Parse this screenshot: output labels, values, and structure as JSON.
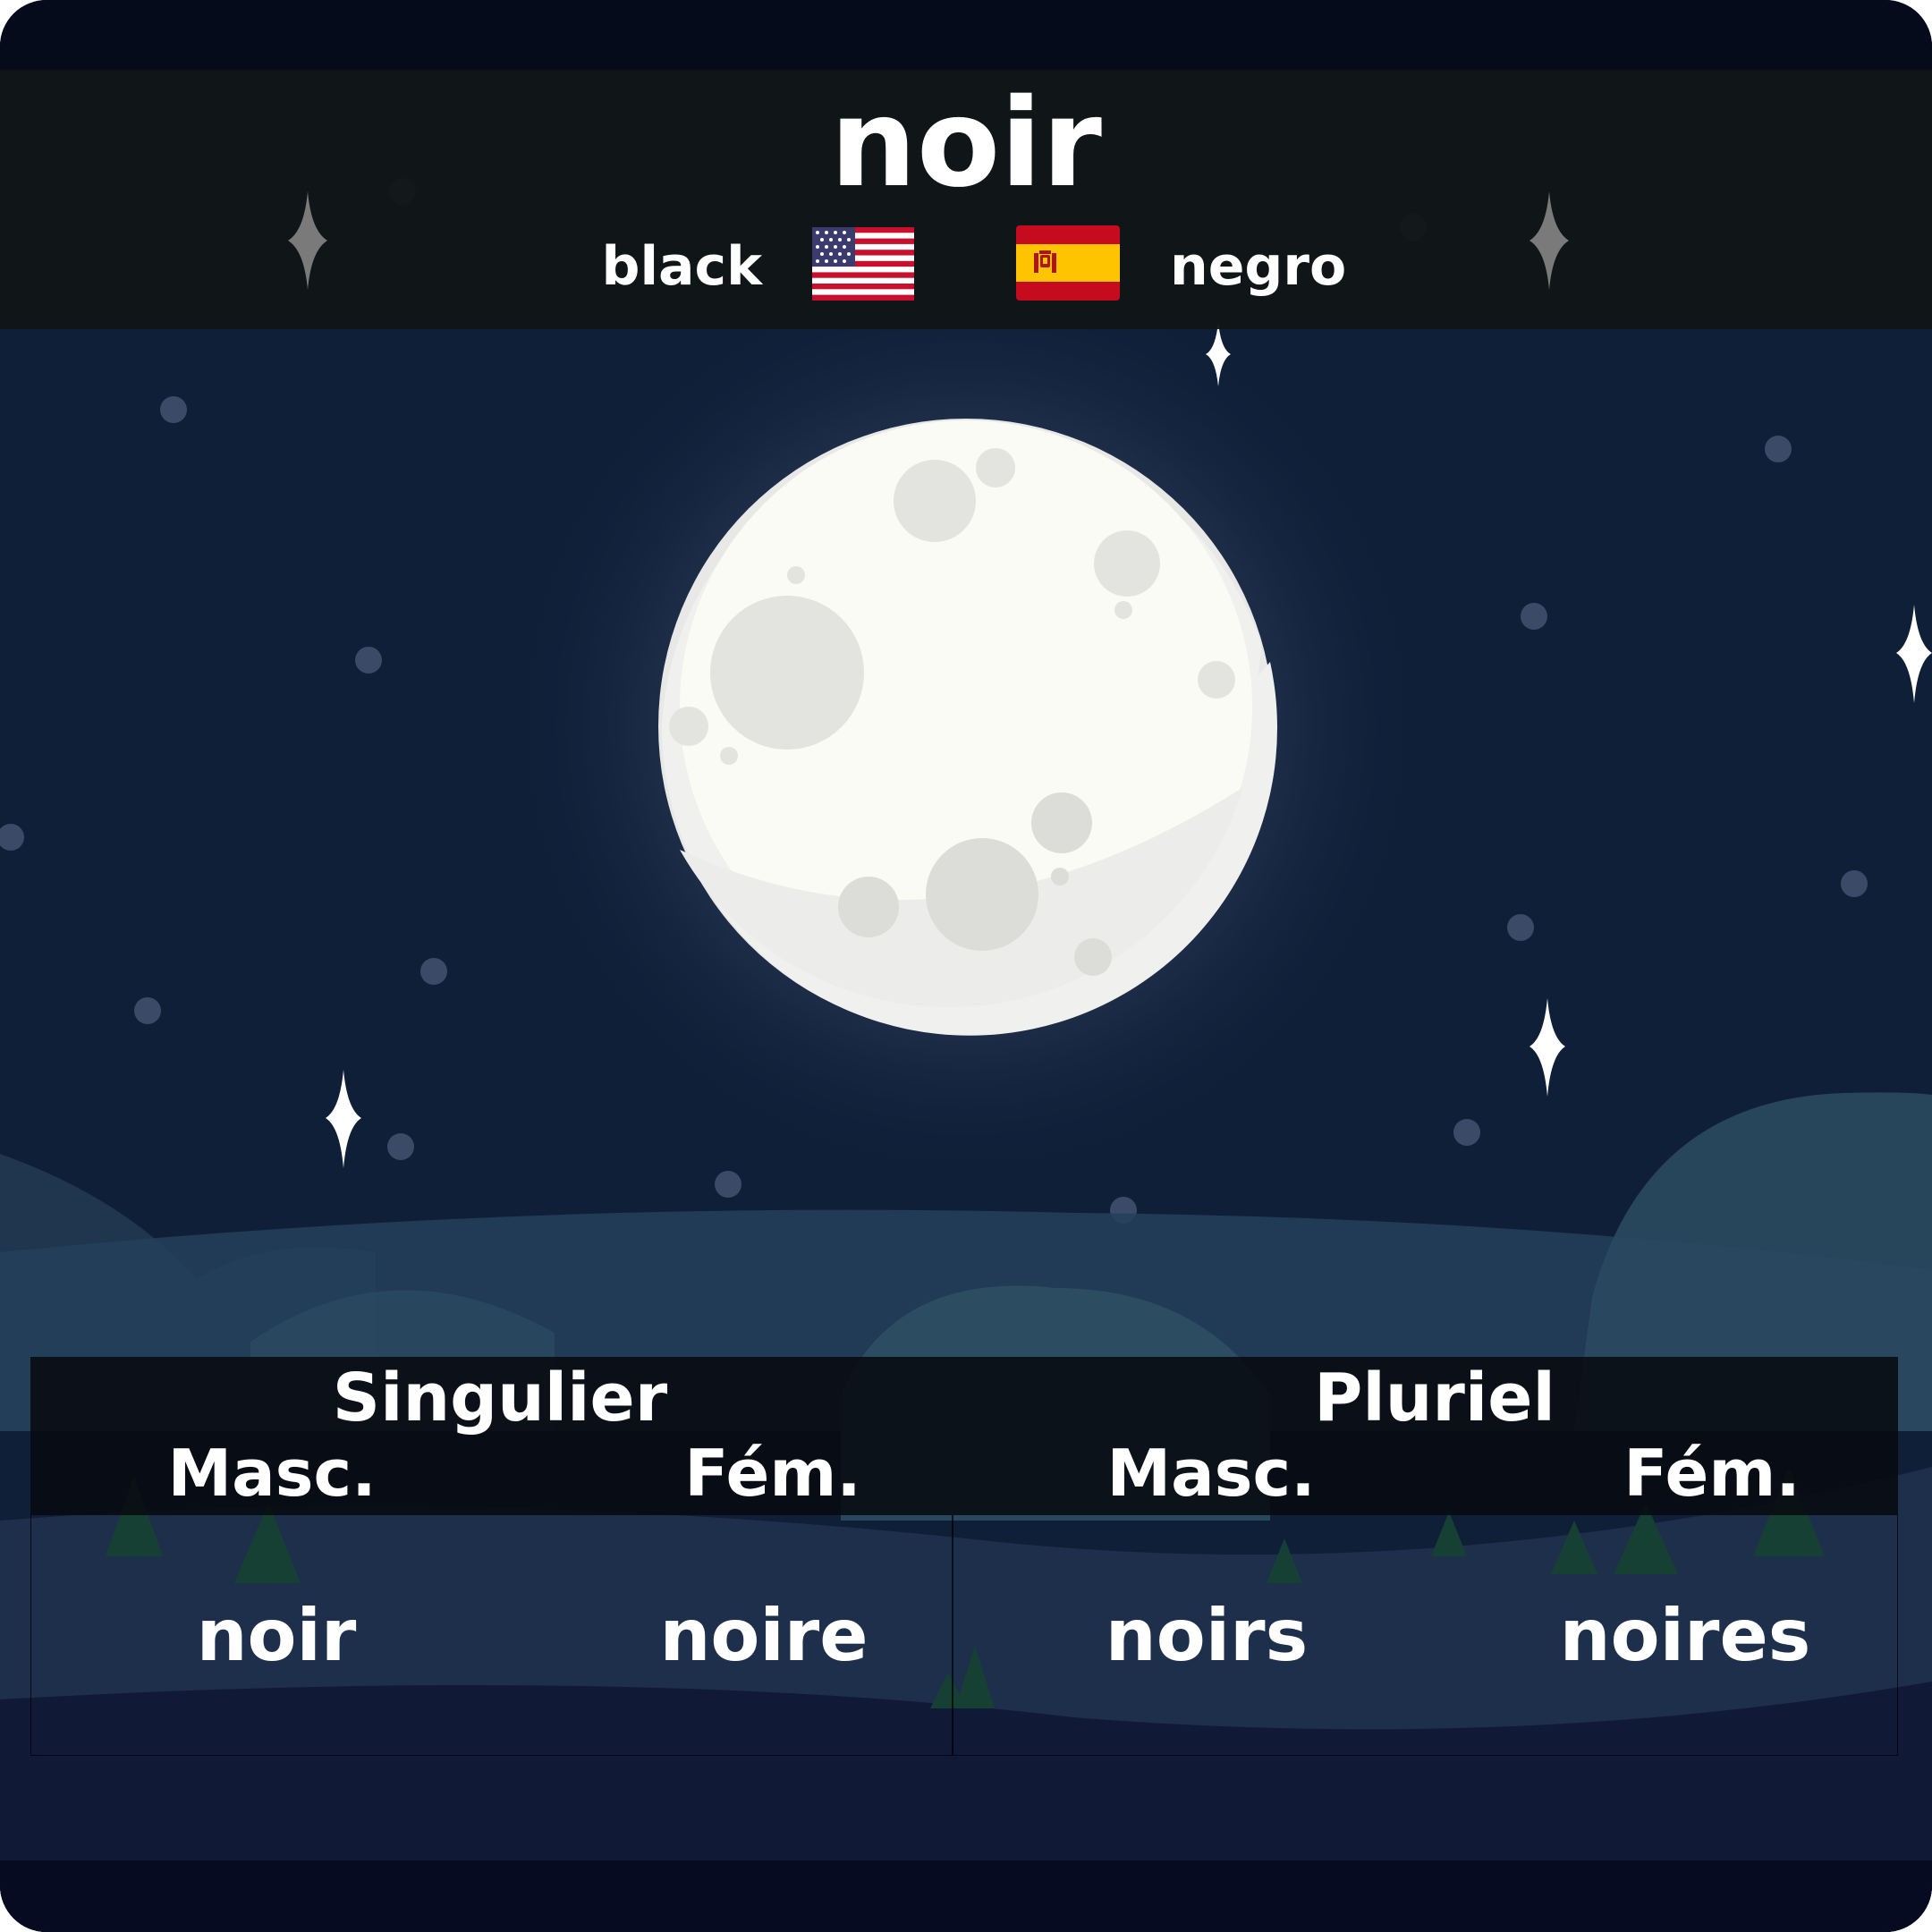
{
  "word": {
    "headword": "noir",
    "translation_en": "black",
    "translation_es": "negro",
    "flag_en_icon": "us-flag-icon",
    "flag_es_icon": "spain-flag-icon"
  },
  "table": {
    "groups": [
      "Singulier",
      "Pluriel"
    ],
    "subheaders": [
      "Masc.",
      "Fém.",
      "Masc.",
      "Fém."
    ],
    "forms": [
      "noir",
      "noire",
      "noirs",
      "noires"
    ]
  },
  "colors": {
    "sky": "#0f1f38",
    "moon": "#fbfbf6",
    "header_bg": "#101416",
    "text": "#ffffff"
  }
}
